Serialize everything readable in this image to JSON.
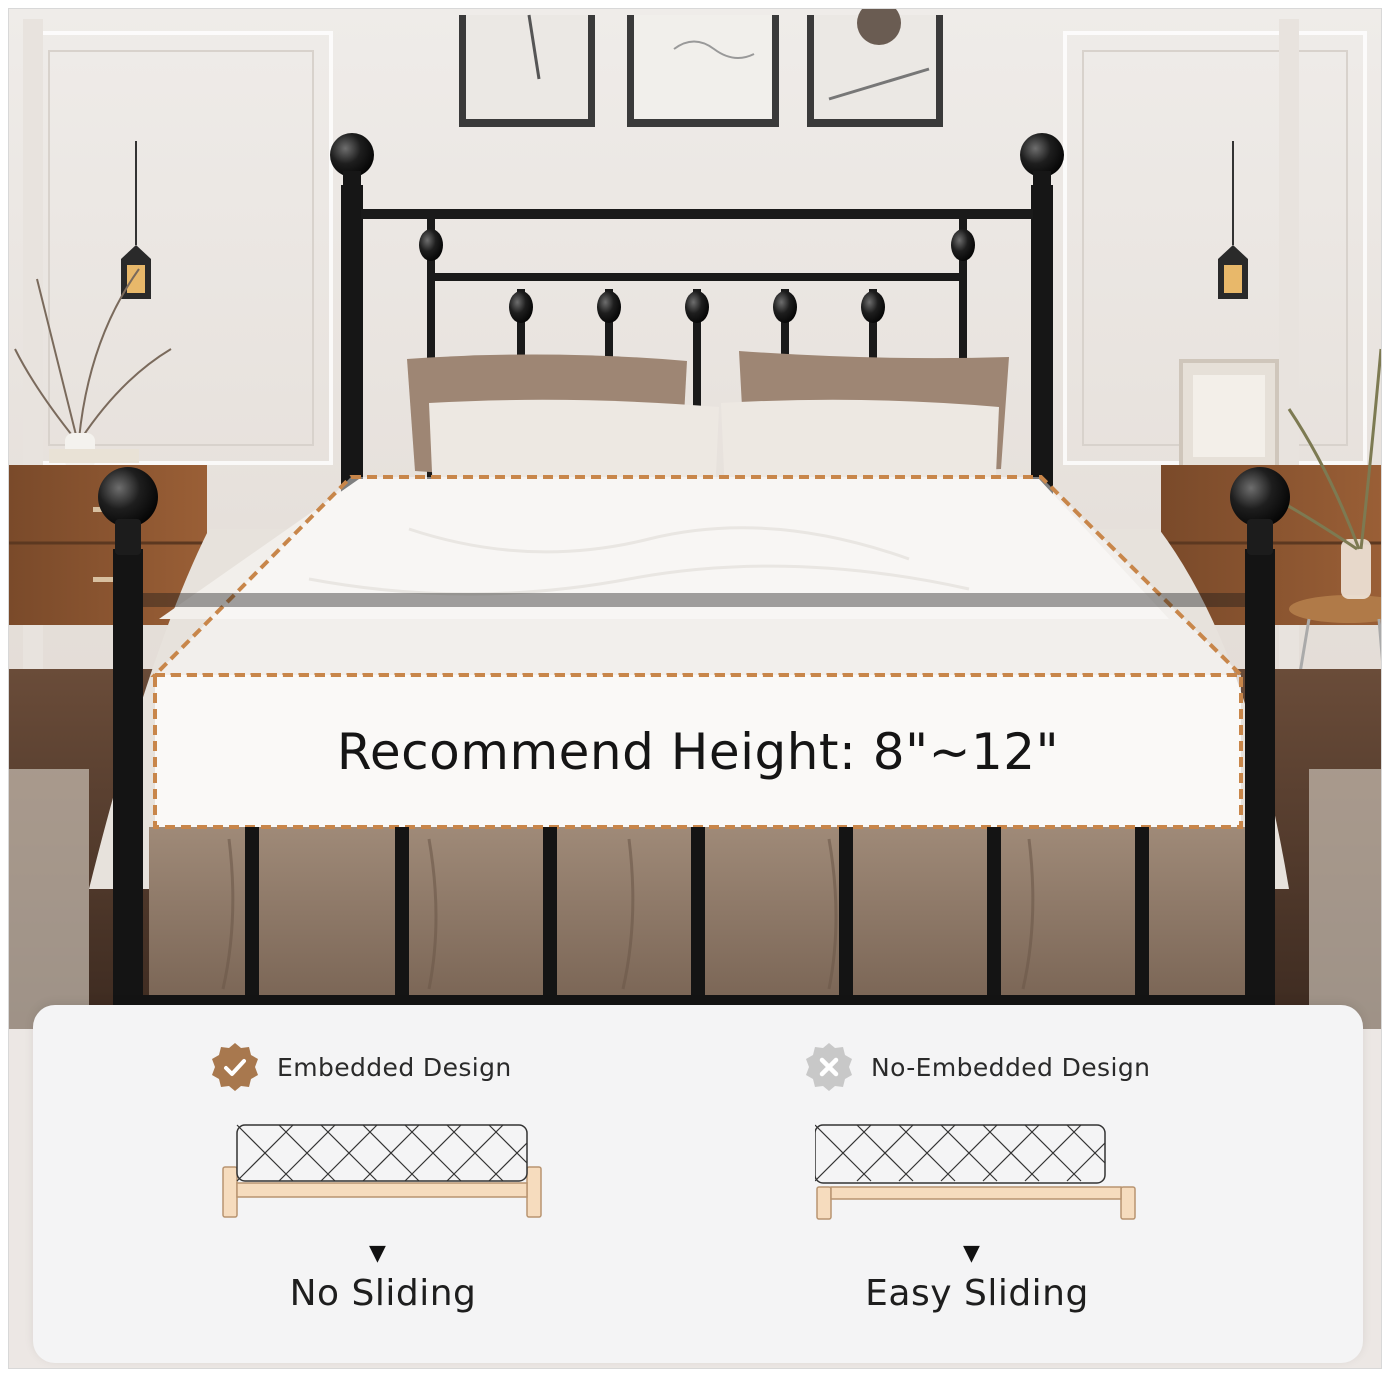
{
  "headline": "Recommend Height: 8\"~12\"",
  "comparison": {
    "left": {
      "label": "Embedded Design",
      "status": "check",
      "status_icon": "check-badge-icon",
      "arrow": "▼",
      "result": "No Sliding",
      "badge_color": "#a8784e"
    },
    "right": {
      "label": "No-Embedded Design",
      "status": "cross",
      "status_icon": "x-badge-icon",
      "arrow": "▼",
      "result": "Easy Sliding",
      "badge_color": "#c8c8c8"
    }
  },
  "colors": {
    "frame_wood": "#f6dcbe",
    "frame_outline": "#b89470",
    "dashed_outline": "#c8864a"
  }
}
